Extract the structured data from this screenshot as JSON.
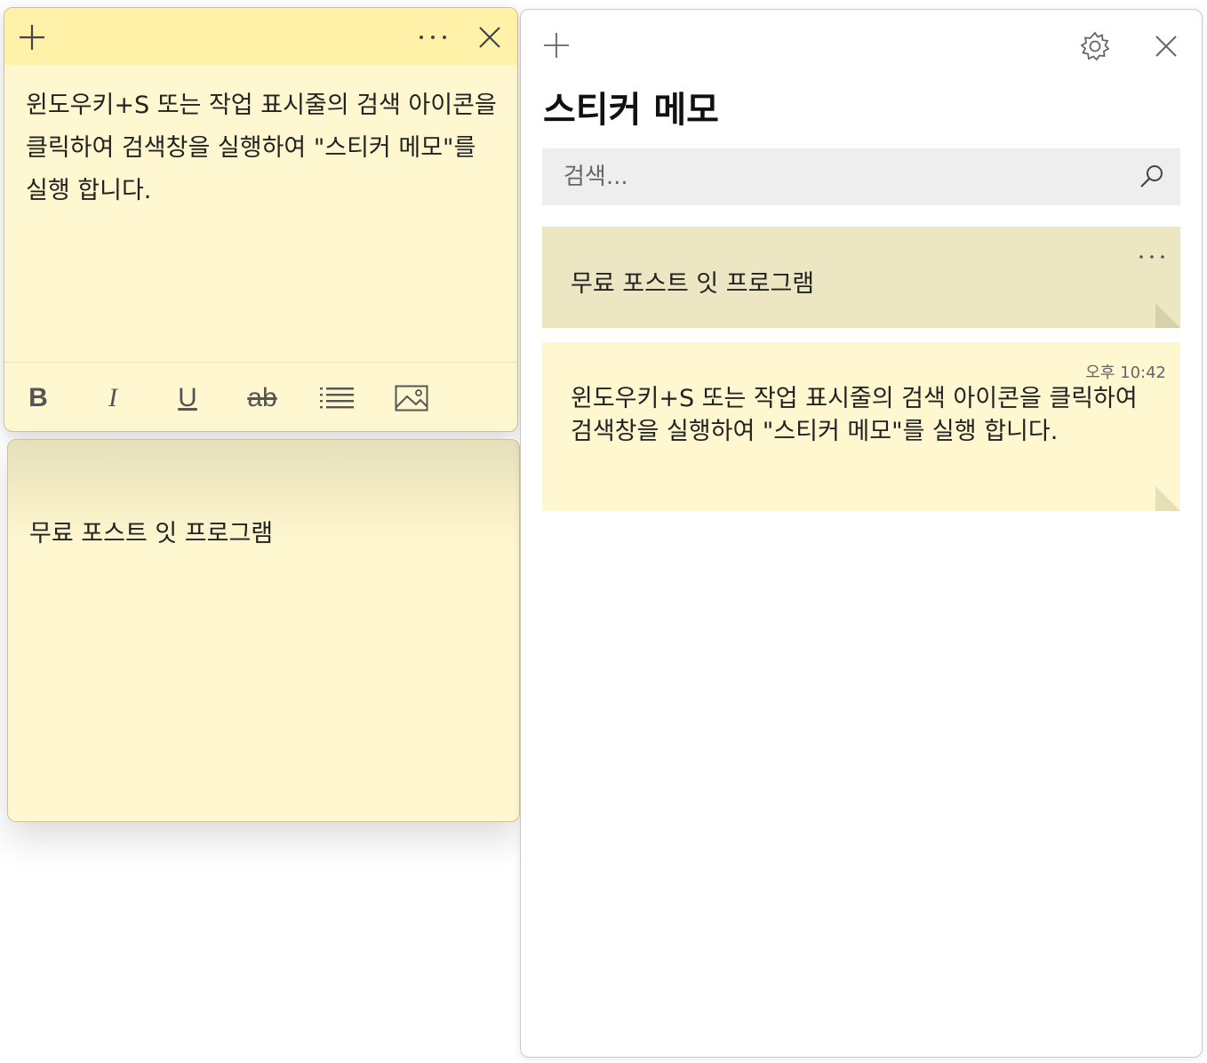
{
  "note_window": {
    "body_text": "윈도우키+S 또는 작업 표시줄의 검색 아이콘을 클릭하여 검색창을 실행하여 \"스티커 메모\"를 실행 합니다.",
    "format_toolbar": {
      "bold_label": "B",
      "italic_label": "I",
      "underline_label": "U",
      "strikethrough_label": "ab"
    }
  },
  "note_window_2": {
    "body_text": "무료 포스트 잇 프로그램"
  },
  "hub": {
    "title": "스티커 메모",
    "search": {
      "placeholder": "검색..."
    },
    "notes": [
      {
        "text": "무료 포스트 잇 프로그램"
      },
      {
        "text": "윈도우키+S 또는 작업 표시줄의 검색 아이콘을 클릭하여 검색창을 실행하여 \"스티커 메모\"를 실행 합니다.",
        "time": "오후 10:42"
      }
    ]
  },
  "colors": {
    "note_yellow": "#fff7cf",
    "note_titlebar": "#fff2a8",
    "card_selected": "#ede6c2",
    "search_background": "#eeeeee"
  }
}
